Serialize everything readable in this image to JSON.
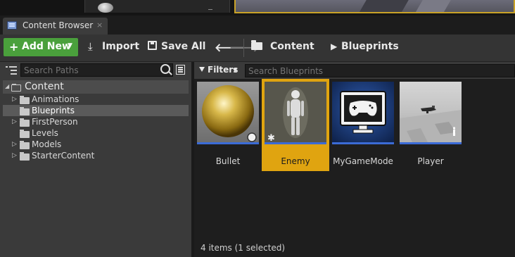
{
  "tab": {
    "title": "Content Browser",
    "close_glyph": "×",
    "icon": "content-browser-icon"
  },
  "toolbar": {
    "add_new_label": "Add New",
    "add_new_icon_glyph": "+",
    "add_new_caret": "▼",
    "import_label": "Import",
    "import_icon_glyph": "⤓",
    "save_all_label": "Save All",
    "back_glyph": "🡐",
    "forward_glyph": "🡒",
    "add_new_color": "#4aa03c"
  },
  "breadcrumb": {
    "items": [
      "Content",
      "Blueprints"
    ],
    "separator": "▶"
  },
  "sources": {
    "search_placeholder": "Search Paths",
    "tree": [
      {
        "label": "Content",
        "expanded": true,
        "selected": false,
        "has_children": true
      },
      {
        "label": "Animations",
        "expanded": false,
        "selected": false,
        "has_children": true
      },
      {
        "label": "Blueprints",
        "expanded": false,
        "selected": true,
        "has_children": false
      },
      {
        "label": "FirstPerson",
        "expanded": false,
        "selected": false,
        "has_children": true
      },
      {
        "label": "Levels",
        "expanded": false,
        "selected": false,
        "has_children": false
      },
      {
        "label": "Models",
        "expanded": false,
        "selected": false,
        "has_children": true
      },
      {
        "label": "StarterContent",
        "expanded": false,
        "selected": false,
        "has_children": true
      }
    ],
    "tree_caret": "▷",
    "tree_caret_open": "◢"
  },
  "assets": {
    "filters_label": "Filters",
    "filters_caret": "▼",
    "search_placeholder": "Search Blueprints",
    "items": [
      {
        "name": "Bullet",
        "icon": "gold-sphere-icon",
        "selected": false
      },
      {
        "name": "Enemy",
        "icon": "mannequin-icon",
        "selected": true
      },
      {
        "name": "MyGameMode",
        "icon": "gamepad-monitor-icon",
        "selected": false
      },
      {
        "name": "Player",
        "icon": "player-scene-icon",
        "selected": false
      }
    ],
    "status": "4 items (1 selected)",
    "selection_color": "#e0a410",
    "asset_bar_color": "#3b6bd6"
  }
}
